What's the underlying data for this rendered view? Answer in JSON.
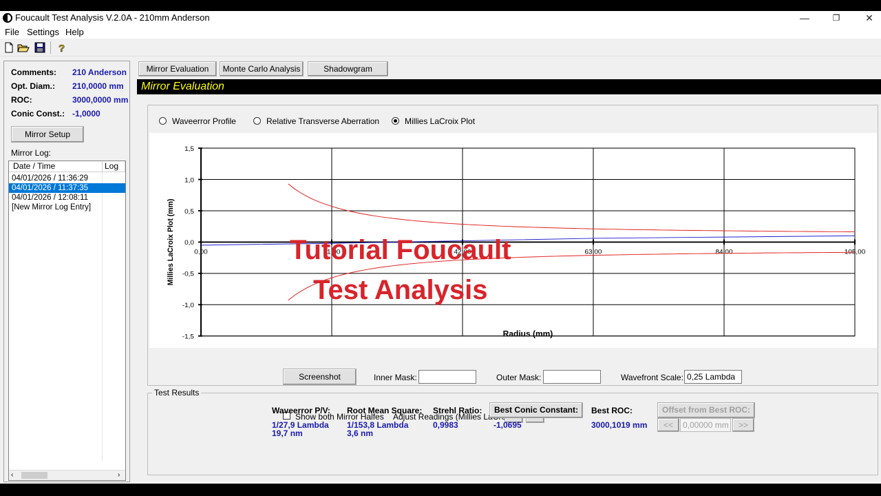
{
  "window": {
    "title": "Foucault Test Analysis V.2.0A - 210mm Anderson",
    "minimize": "—",
    "maximize": "❐",
    "close": "✕"
  },
  "menu": [
    "File",
    "Settings",
    "Help"
  ],
  "toolbar": {
    "icons": [
      "new-file-icon",
      "open-folder-icon",
      "save-disk-icon",
      "help-icon"
    ]
  },
  "mirror_info": {
    "comments_label": "Comments:",
    "comments_value": "210 Anderson",
    "diam_label": "Opt. Diam.:",
    "diam_value": "210,0000 mm",
    "roc_label": "ROC:",
    "roc_value": "3000,0000 mm",
    "conic_label": "Conic Const.:",
    "conic_value": "-1,0000",
    "setup_button": "Mirror Setup",
    "log_label": "Mirror Log:"
  },
  "mirror_log": {
    "columns": [
      "Date / Time",
      "Log E"
    ],
    "rows": [
      {
        "text": "04/01/2026 / 11:36:29",
        "selected": false
      },
      {
        "text": "04/01/2026 / 11:37:35",
        "selected": true
      },
      {
        "text": "04/01/2026 / 12:08:11",
        "selected": false
      },
      {
        "text": "[New Mirror Log Entry]",
        "selected": false
      }
    ]
  },
  "tabs": [
    "Mirror Evaluation",
    "Monte Carlo Analysis",
    "Shadowgram"
  ],
  "section_title": "Mirror Evaluation",
  "plot_options": {
    "options": [
      "Waveerror Profile",
      "Relative Transverse Aberration",
      "Millies LaCroix Plot"
    ],
    "selected_index": 2
  },
  "chart_data": {
    "type": "line",
    "xlabel": "Radius (mm)",
    "ylabel": "Millies LaCroix Plot (mm)",
    "xlim": [
      0,
      105
    ],
    "ylim": [
      -1.5,
      1.5
    ],
    "x_ticks": [
      "0,00",
      "21,00",
      "42,00",
      "63,00",
      "84,00",
      "105,00"
    ],
    "y_ticks": [
      "1,5",
      "1,0",
      "0,5",
      "0,0",
      "-0,5",
      "-1,0",
      "-1,5"
    ],
    "grid": true,
    "colors": {
      "tolerance": "#e02020",
      "measured": "#2020d0",
      "axis": "#000000"
    },
    "series": [
      {
        "role": "tolerance-upper",
        "x": [
          14,
          21,
          30,
          42,
          63,
          84,
          105
        ],
        "y": [
          1.05,
          0.68,
          0.48,
          0.34,
          0.22,
          0.16,
          0.12
        ]
      },
      {
        "role": "tolerance-lower",
        "x": [
          14,
          21,
          30,
          42,
          63,
          84,
          105
        ],
        "y": [
          -1.05,
          -0.68,
          -0.48,
          -0.34,
          -0.22,
          -0.16,
          -0.12
        ]
      },
      {
        "role": "measured",
        "x": [
          0,
          21,
          42,
          63,
          84,
          105
        ],
        "y": [
          -0.05,
          -0.02,
          0.02,
          0.06,
          0.08,
          0.1
        ]
      }
    ]
  },
  "watermark": {
    "line1": "Tutorial Foucault",
    "line2": "Test Analysis"
  },
  "controls": {
    "screenshot_button": "Screenshot",
    "inner_mask_label": "Inner Mask:",
    "inner_mask_value": "",
    "outer_mask_label": "Outer Mask:",
    "outer_mask_value": "",
    "wavefront_scale_label": "Wavefront Scale:",
    "wavefront_scale_value": "0,25 Lambda",
    "show_halves_label": "Show both Mirror Halfes",
    "adjust_label": "Adjust Readings (Millies LaCroix):",
    "prev": "<<",
    "next": ">>"
  },
  "test_results": {
    "group_label": "Test Results",
    "pv_label": "Waveerror P/V:",
    "pv_value1": "1/27,9 Lambda",
    "pv_value2": "19,7 nm",
    "rms_label": "Root Mean Square:",
    "rms_value1": "1/153,8 Lambda",
    "rms_value2": "3,6 nm",
    "strehl_label": "Strehl Ratio:",
    "strehl_value": "0,9983",
    "best_conic_button": "Best Conic Constant:",
    "best_conic_value": "-1,0695",
    "best_roc_label": "Best ROC:",
    "best_roc_value": "3000,1019 mm",
    "offset_button": "Offset from Best ROC:",
    "offset_value": "0,00000 mm",
    "prev": "<<",
    "next": ">>"
  }
}
